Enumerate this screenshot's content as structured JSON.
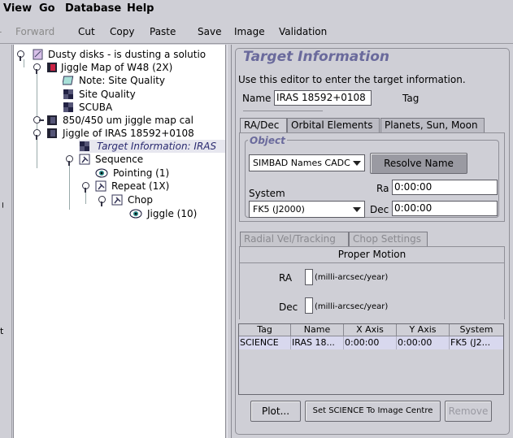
{
  "menubar": {
    "view": "View",
    "go": "Go",
    "database": "Database",
    "help": "Help"
  },
  "toolbar": {
    "forward": "Forward",
    "cut": "Cut",
    "copy": "Copy",
    "paste": "Paste",
    "save": "Save",
    "image": "Image",
    "validation": "Validation"
  },
  "tree": {
    "items": [
      {
        "label": "Dusty disks - is dusting a solutio",
        "icon": "msb-folder-icon"
      },
      {
        "label": "Jiggle Map of W48 (2X)",
        "icon": "observation-icon"
      },
      {
        "label": "Note: Site Quality",
        "icon": "note-icon"
      },
      {
        "label": "Site Quality",
        "icon": "component-icon"
      },
      {
        "label": "SCUBA",
        "icon": "component-icon"
      },
      {
        "label": "850/450 um jiggle map cal",
        "icon": "observation-icon"
      },
      {
        "label": "Jiggle of IRAS 18592+0108",
        "icon": "observation-icon"
      },
      {
        "label": "Target Information: IRAS",
        "icon": "target-icon"
      },
      {
        "label": "Sequence",
        "icon": "sequence-icon"
      },
      {
        "label": "Pointing (1)",
        "icon": "eye-icon"
      },
      {
        "label": "Repeat (1X)",
        "icon": "repeat-icon"
      },
      {
        "label": "Chop",
        "icon": "chop-icon"
      },
      {
        "label": "Jiggle (10)",
        "icon": "eye-icon"
      }
    ]
  },
  "editor": {
    "title": "Target Information",
    "description": "Use this editor to enter the target information.",
    "name_label": "Name",
    "name_value": "IRAS 18592+0108",
    "tag_label": "Tag",
    "tabs": [
      "RA/Dec",
      "Orbital Elements",
      "Planets, Sun, Moon"
    ],
    "object_label": "Object",
    "name_server": "SIMBAD Names CADC",
    "resolve_button": "Resolve Name",
    "system_label": "System",
    "system_value": "FK5 (J2000)",
    "ra_label": "Ra",
    "ra_value": "0:00:00",
    "dec_label": "Dec",
    "dec_value": "0:00:00",
    "subtabs": [
      "Radial Vel/Tracking",
      "Chop Settings"
    ],
    "proper_motion_title": "Proper Motion",
    "pm_ra_label": "RA",
    "pm_ra_unit": "(milli-arcsec/year)",
    "pm_dec_label": "Dec",
    "pm_dec_unit": "(milli-arcsec/year)",
    "table": {
      "headers": [
        "Tag",
        "Name",
        "X Axis",
        "Y Axis",
        "System"
      ],
      "rows": [
        [
          "SCIENCE",
          "IRAS 18...",
          "0:00:00",
          "0:00:00",
          "FK5 (J2..."
        ]
      ]
    },
    "plot_button": "Plot...",
    "set_science_button": "Set SCIENCE To Image Centre",
    "remove_button": "Remove"
  },
  "colors": {
    "background": "#cfcfd6",
    "title": "#6a6a9c",
    "selection": "#d8d8ee"
  }
}
